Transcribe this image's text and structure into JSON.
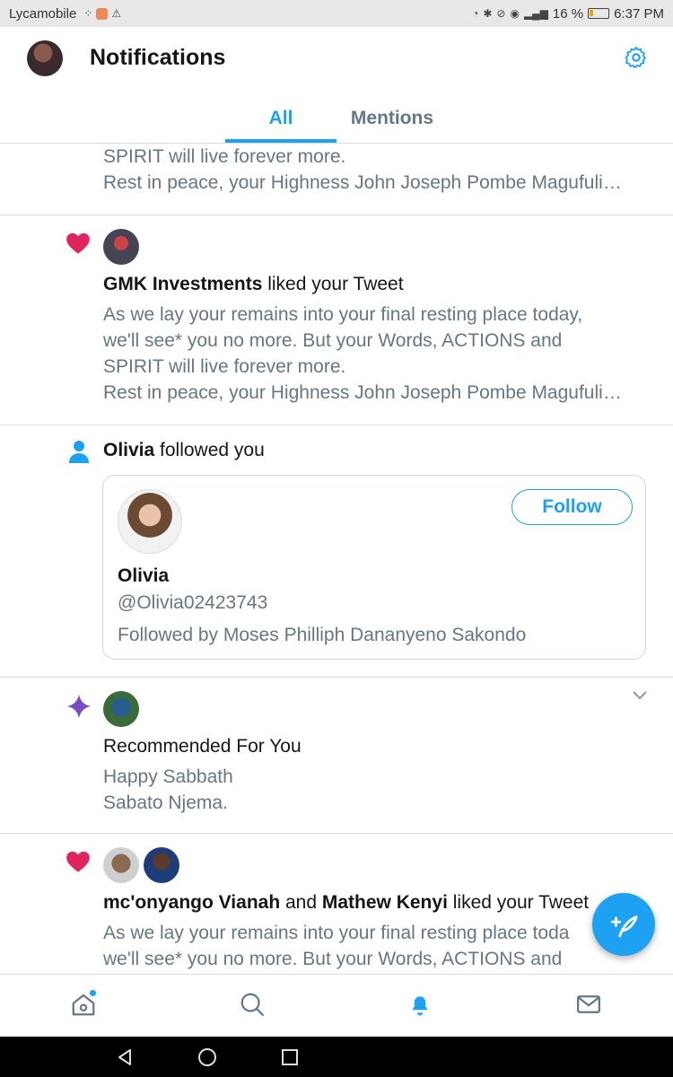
{
  "status_bar": {
    "carrier": "Lycamobile",
    "battery_percent": "16 %",
    "time": "6:37 PM"
  },
  "header": {
    "title": "Notifications",
    "tabs": [
      {
        "label": "All",
        "active": true
      },
      {
        "label": "Mentions",
        "active": false
      }
    ]
  },
  "notifications": [
    {
      "type": "tweet-continuation",
      "lines": [
        "SPIRIT will live forever more.",
        "Rest in peace, your Highness John Joseph Pombe Magufuli…"
      ]
    },
    {
      "type": "like",
      "icon": "heart-icon",
      "actor": "GMK Investments",
      "action": " liked your Tweet",
      "lines": [
        "As we lay your remains into your final resting place today,",
        "we'll see* you no more. But your Words, ACTIONS and",
        "SPIRIT will live forever more.",
        "Rest in peace, your Highness John Joseph Pombe Magufuli…"
      ]
    },
    {
      "type": "follow",
      "icon": "person-icon",
      "actor": "Olivia",
      "action": " followed you",
      "card": {
        "name": "Olivia",
        "handle": "@Olivia02423743",
        "followed_by": "Followed by Moses Philliph Dananyeno Sakondo",
        "follow_label": "Follow"
      }
    },
    {
      "type": "recommended",
      "icon": "sparkle-icon",
      "headline": "Recommended For You",
      "lines": [
        "Happy Sabbath",
        "Sabato Njema."
      ]
    },
    {
      "type": "like",
      "icon": "heart-icon",
      "actor": "mc'onyango Vianah",
      "joiner": " and ",
      "actor2": "Mathew Kenyi",
      "action": " liked your Tweet",
      "lines": [
        "As we lay your remains into your final resting place toda",
        "we'll see* you no more. But your Words, ACTIONS and"
      ]
    }
  ],
  "colors": {
    "accent": "#1da1f2",
    "like": "#e0245e",
    "sparkle": "#794bc4",
    "secondary_text": "#657786"
  }
}
